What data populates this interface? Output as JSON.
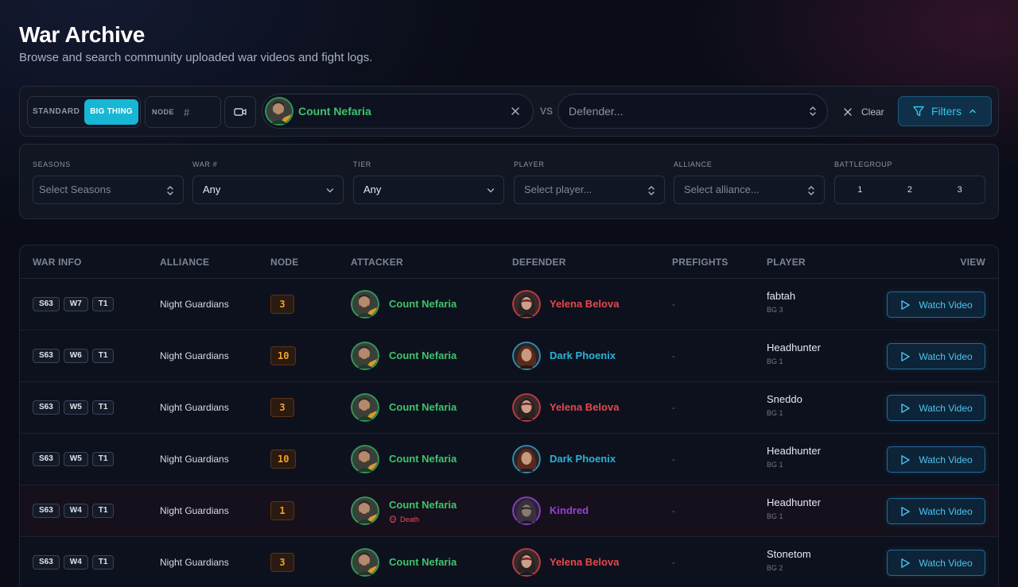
{
  "header": {
    "title": "War Archive",
    "subtitle": "Browse and search community uploaded war videos and fight logs."
  },
  "searchbar": {
    "mode_standard": "STANDARD",
    "mode_big": "BIG THING",
    "node_label": "NODE",
    "node_placeholder": "#",
    "attacker": "Count Nefaria",
    "vs": "VS",
    "defender_placeholder": "Defender...",
    "clear_label": "Clear",
    "filters_label": "Filters"
  },
  "filters": {
    "seasons": {
      "label": "SEASONS",
      "placeholder": "Select Seasons"
    },
    "war": {
      "label": "WAR #",
      "value": "Any"
    },
    "tier": {
      "label": "TIER",
      "value": "Any"
    },
    "player": {
      "label": "PLAYER",
      "placeholder": "Select player..."
    },
    "alliance": {
      "label": "ALLIANCE",
      "placeholder": "Select alliance..."
    },
    "battlegroup": {
      "label": "BATTLEGROUP",
      "options": [
        "1",
        "2",
        "3"
      ]
    }
  },
  "table": {
    "headers": {
      "war_info": "WAR INFO",
      "alliance": "ALLIANCE",
      "node": "NODE",
      "attacker": "ATTACKER",
      "defender": "DEFENDER",
      "prefights": "PREFIGHTS",
      "player": "PLAYER",
      "view": "VIEW"
    },
    "watch_label": "Watch Video",
    "death_label": "Death",
    "rows": [
      {
        "season": "S63",
        "war": "W7",
        "tier": "T1",
        "alliance": "Night Guardians",
        "node": "3",
        "attacker": "Count Nefaria",
        "defender": "Yelena Belova",
        "prefights": "-",
        "player": "fabtah",
        "bg": "BG 3"
      },
      {
        "season": "S63",
        "war": "W6",
        "tier": "T1",
        "alliance": "Night Guardians",
        "node": "10",
        "attacker": "Count Nefaria",
        "defender": "Dark Phoenix",
        "prefights": "-",
        "player": "Headhunter",
        "bg": "BG 1"
      },
      {
        "season": "S63",
        "war": "W5",
        "tier": "T1",
        "alliance": "Night Guardians",
        "node": "3",
        "attacker": "Count Nefaria",
        "defender": "Yelena Belova",
        "prefights": "-",
        "player": "Sneddo",
        "bg": "BG 1"
      },
      {
        "season": "S63",
        "war": "W5",
        "tier": "T1",
        "alliance": "Night Guardians",
        "node": "10",
        "attacker": "Count Nefaria",
        "defender": "Dark Phoenix",
        "prefights": "-",
        "player": "Headhunter",
        "bg": "BG 1"
      },
      {
        "season": "S63",
        "war": "W4",
        "tier": "T1",
        "alliance": "Night Guardians",
        "node": "1",
        "attacker": "Count Nefaria",
        "defender": "Kindred",
        "prefights": "-",
        "player": "Headhunter",
        "bg": "BG 1"
      },
      {
        "season": "S63",
        "war": "W4",
        "tier": "T1",
        "alliance": "Night Guardians",
        "node": "3",
        "attacker": "Count Nefaria",
        "defender": "Yelena Belova",
        "prefights": "-",
        "player": "Stonetom",
        "bg": "BG 2"
      }
    ]
  },
  "colors": {
    "accent": "#17b6d4",
    "attacker_green": "#3ec46b",
    "defender_red": "#e5484d",
    "defender_blue": "#27b4d8",
    "defender_purple": "#9b3fd6",
    "node_orange": "#f3a12b",
    "death_red": "#e2505b"
  },
  "icons": {
    "video": "video-camera-icon",
    "clear": "close-icon",
    "select": "chevron-up-down-icon",
    "dropdown": "chevron-down-icon",
    "filter": "funnel-icon",
    "collapse": "chevron-up-icon",
    "play": "play-icon",
    "death": "skull-icon"
  }
}
